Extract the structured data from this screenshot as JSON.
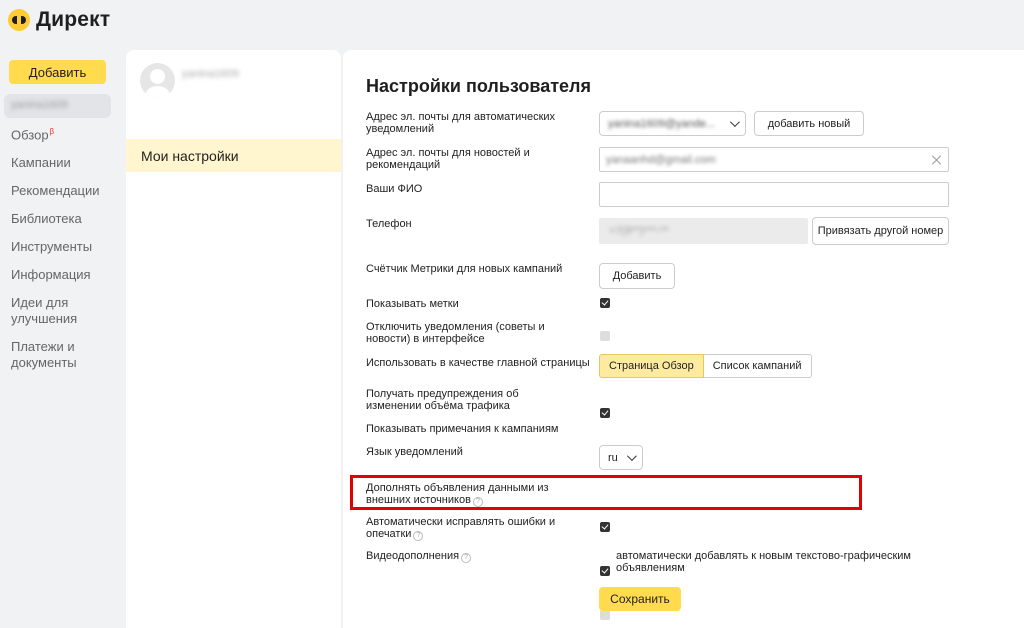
{
  "app": {
    "logo_text": "Директ",
    "brand_color": "#fc3"
  },
  "sidebar": {
    "add_button": "Добавить",
    "user": "yanina1609",
    "items": [
      {
        "label": "Обзор",
        "badge": "β"
      },
      {
        "label": "Кампании"
      },
      {
        "label": "Рекомендации"
      },
      {
        "label": "Библиотека"
      },
      {
        "label": "Инструменты"
      },
      {
        "label": "Информация"
      },
      {
        "label": "Идеи для улучшения"
      },
      {
        "label": "Платежи и документы"
      }
    ]
  },
  "middle": {
    "username": "yanina1609",
    "menu_item": "Мои настройки"
  },
  "settings": {
    "title": "Настройки пользователя",
    "email_auto": {
      "label": "Адрес эл. почты для автоматических уведомлений",
      "value": "yanina1609@yande...",
      "add_button": "добавить новый"
    },
    "email_news": {
      "label": "Адрес эл. почты для новостей и рекомендаций",
      "value": "yanaanhd@gmail.com"
    },
    "fio": {
      "label": "Ваши ФИО",
      "value": ""
    },
    "phone": {
      "label": "Телефон",
      "value": "+7(9**)***-**",
      "button": "Привязать другой номер"
    },
    "metrika": {
      "label": "Счётчик Метрики для новых кампаний",
      "button": "Добавить"
    },
    "show_labels": {
      "label": "Показывать метки",
      "checked": true
    },
    "disable_notifications": {
      "label": "Отключить уведомления (советы и новости) в интерфейсе",
      "checked": false
    },
    "main_page": {
      "label": "Использовать в качестве главной страницы",
      "options": [
        "Страница Обзор",
        "Список кампаний"
      ],
      "selected": "Страница Обзор"
    },
    "traffic_warnings": {
      "label": "Получать предупреждения об изменении объёма трафика",
      "checked": true
    },
    "show_notes": {
      "label": "Показывать примечания к кампаниям",
      "checked": false
    },
    "language": {
      "label": "Язык уведомлений",
      "value": "ru"
    },
    "external_data": {
      "label": "Дополнять объявления данными из внешних источников",
      "checked": true
    },
    "autocorrect": {
      "label": "Автоматически исправлять ошибки и опечатки",
      "checked": true
    },
    "video": {
      "label": "Видеодополнения",
      "option_text": "автоматически добавлять к новым текстово-графическим объявлениям",
      "checked": false
    },
    "save_button": "Сохранить",
    "highlight_color": "#e30000"
  }
}
